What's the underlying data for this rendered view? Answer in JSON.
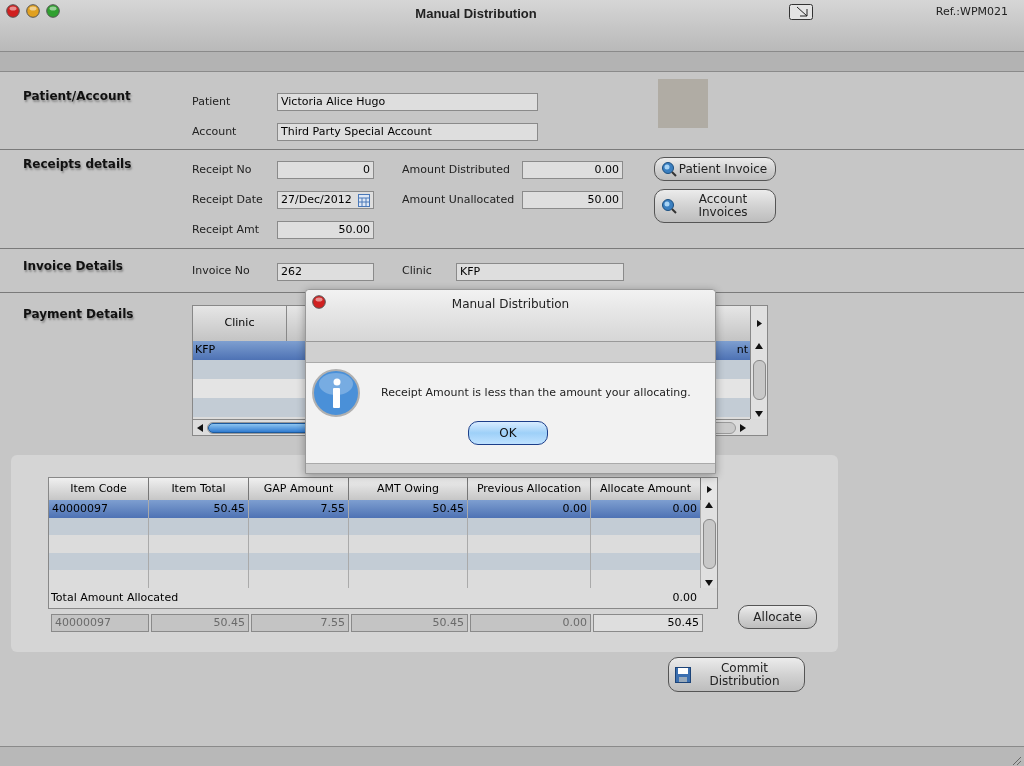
{
  "window": {
    "title": "Manual Distribution",
    "ref": "Ref.:WPM021"
  },
  "patient_account": {
    "heading": "Patient/Account",
    "fields": [
      {
        "label": "Patient",
        "value": "Victoria Alice Hugo"
      },
      {
        "label": "Account",
        "value": "Third Party Special Account"
      }
    ]
  },
  "receipts": {
    "heading": "Receipts details",
    "left_fields": [
      {
        "label": "Receipt No",
        "value": "0",
        "kind": "number"
      },
      {
        "label": "Receipt Date",
        "value": "27/Dec/2012",
        "kind": "date"
      },
      {
        "label": "Receipt Amt",
        "value": "50.00",
        "kind": "number"
      }
    ],
    "right_fields": [
      {
        "label": "Amount Distributed",
        "value": "0.00"
      },
      {
        "label": "Amount Unallocated",
        "value": "50.00"
      }
    ],
    "buttons": [
      "Patient Invoice",
      "Account Invoices"
    ]
  },
  "invoice": {
    "heading": "Invoice Details",
    "fields": [
      {
        "label": "Invoice No",
        "value": "262"
      },
      {
        "label": "Clinic",
        "value": "KFP"
      }
    ]
  },
  "payment": {
    "heading": "Payment Details",
    "columns": [
      "Clinic"
    ],
    "rows": [
      {
        "selected": true,
        "clinic": "KFP",
        "column_cut": "nt"
      },
      {
        "selected": false
      },
      {
        "selected": false
      },
      {
        "selected": false
      }
    ]
  },
  "items": {
    "columns": [
      "Item Code",
      "Item Total",
      "GAP Amount",
      "AMT Owing",
      "Previous Allocation",
      "Allocate Amount"
    ],
    "rows": [
      {
        "selected": true,
        "cells": [
          "40000097",
          "50.45",
          "7.55",
          "50.45",
          "0.00",
          "0.00"
        ]
      },
      {
        "selected": false
      },
      {
        "selected": false
      },
      {
        "selected": false
      },
      {
        "selected": false
      }
    ],
    "total_label": "Total Amount Allocated",
    "total_value": "0.00",
    "edit_row": [
      {
        "value": "40000097",
        "disabled": true
      },
      {
        "value": "50.45",
        "disabled": true
      },
      {
        "value": "7.55",
        "disabled": true
      },
      {
        "value": "50.45",
        "disabled": true
      },
      {
        "value": "0.00",
        "disabled": true
      },
      {
        "value": "50.45",
        "disabled": false
      }
    ],
    "allocate_button": "Allocate"
  },
  "commit_button": "Commit Distribution",
  "dialog": {
    "title": "Manual Distribution",
    "message": "Receipt Amount is less than the amount your allocating.",
    "button": "OK"
  }
}
